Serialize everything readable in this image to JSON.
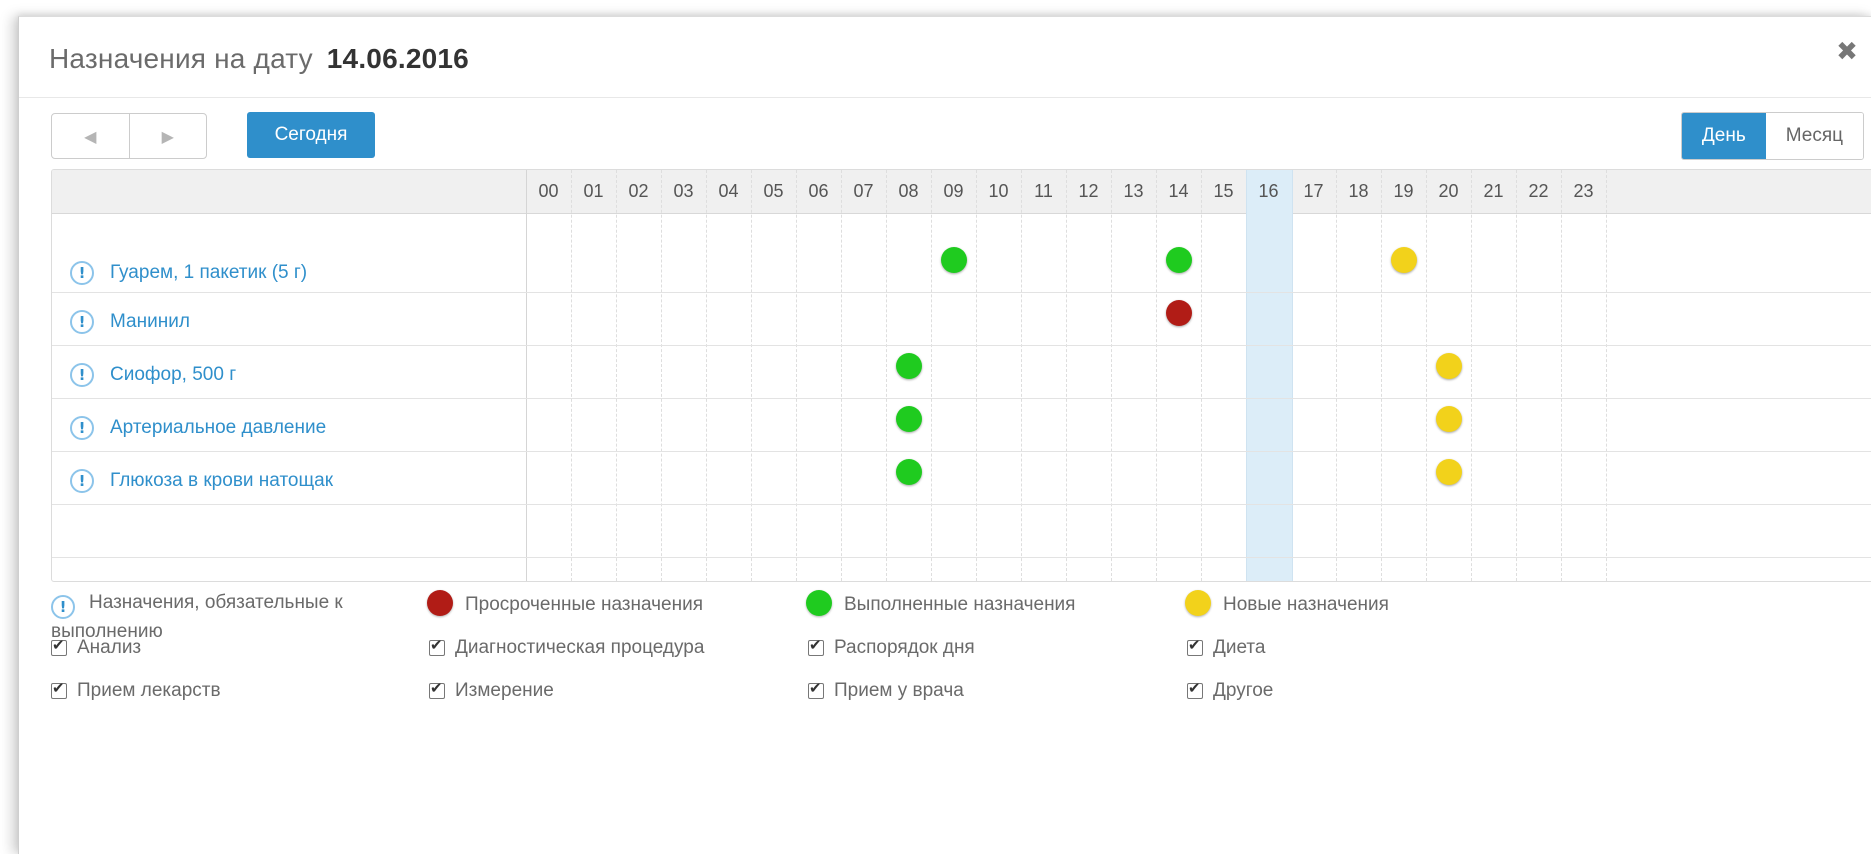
{
  "title": {
    "label": "Назначения на дату",
    "date": "14.06.2016"
  },
  "icons": {
    "close": "close-icon",
    "prev": "triangle-left-icon",
    "next": "triangle-right-icon",
    "required": "exclamation-circle-icon",
    "checkbox": "checkmark-icon"
  },
  "toolbar": {
    "prev_glyph": "◀",
    "next_glyph": "▶",
    "today_label": "Сегодня",
    "views": [
      {
        "label": "День",
        "active": true
      },
      {
        "label": "Месяц",
        "active": false
      }
    ]
  },
  "schedule": {
    "hours": [
      "00",
      "01",
      "02",
      "03",
      "04",
      "05",
      "06",
      "07",
      "08",
      "09",
      "10",
      "11",
      "12",
      "13",
      "14",
      "15",
      "16",
      "17",
      "18",
      "19",
      "20",
      "21",
      "22",
      "23"
    ],
    "current_hour": "16",
    "rows": [
      {
        "label": "Гуарем, 1 пакетик (5 г)",
        "events": [
          {
            "hour": 9,
            "status": "done"
          },
          {
            "hour": 14,
            "status": "done"
          },
          {
            "hour": 19,
            "status": "new"
          }
        ]
      },
      {
        "label": "Манинил",
        "events": [
          {
            "hour": 14,
            "status": "overdue"
          }
        ]
      },
      {
        "label": "Сиофор, 500 г",
        "events": [
          {
            "hour": 8,
            "status": "done"
          },
          {
            "hour": 20,
            "status": "new"
          }
        ]
      },
      {
        "label": "Артериальное давление",
        "events": [
          {
            "hour": 8,
            "status": "done"
          },
          {
            "hour": 20,
            "status": "new"
          }
        ]
      },
      {
        "label": "Глюкоза в крови натощак",
        "events": [
          {
            "hour": 8,
            "status": "done"
          },
          {
            "hour": 20,
            "status": "new"
          }
        ]
      }
    ]
  },
  "status_colors": {
    "overdue": "#b11c16",
    "done": "#1fcb1f",
    "new": "#f2d21b",
    "accent": "#2f8fcb"
  },
  "legend": {
    "required": "Назначения, обязательные к выполнению",
    "overdue": "Просроченные назначения",
    "done": "Выполненные назначения",
    "new": "Новые назначения"
  },
  "filters": [
    {
      "label": "Анализ",
      "checked": true
    },
    {
      "label": "Диагностическая процедура",
      "checked": true
    },
    {
      "label": "Распорядок дня",
      "checked": true
    },
    {
      "label": "Диета",
      "checked": true
    },
    {
      "label": "Прием лекарств",
      "checked": true
    },
    {
      "label": "Измерение",
      "checked": true
    },
    {
      "label": "Прием у врача",
      "checked": true
    },
    {
      "label": "Другое",
      "checked": true
    }
  ]
}
